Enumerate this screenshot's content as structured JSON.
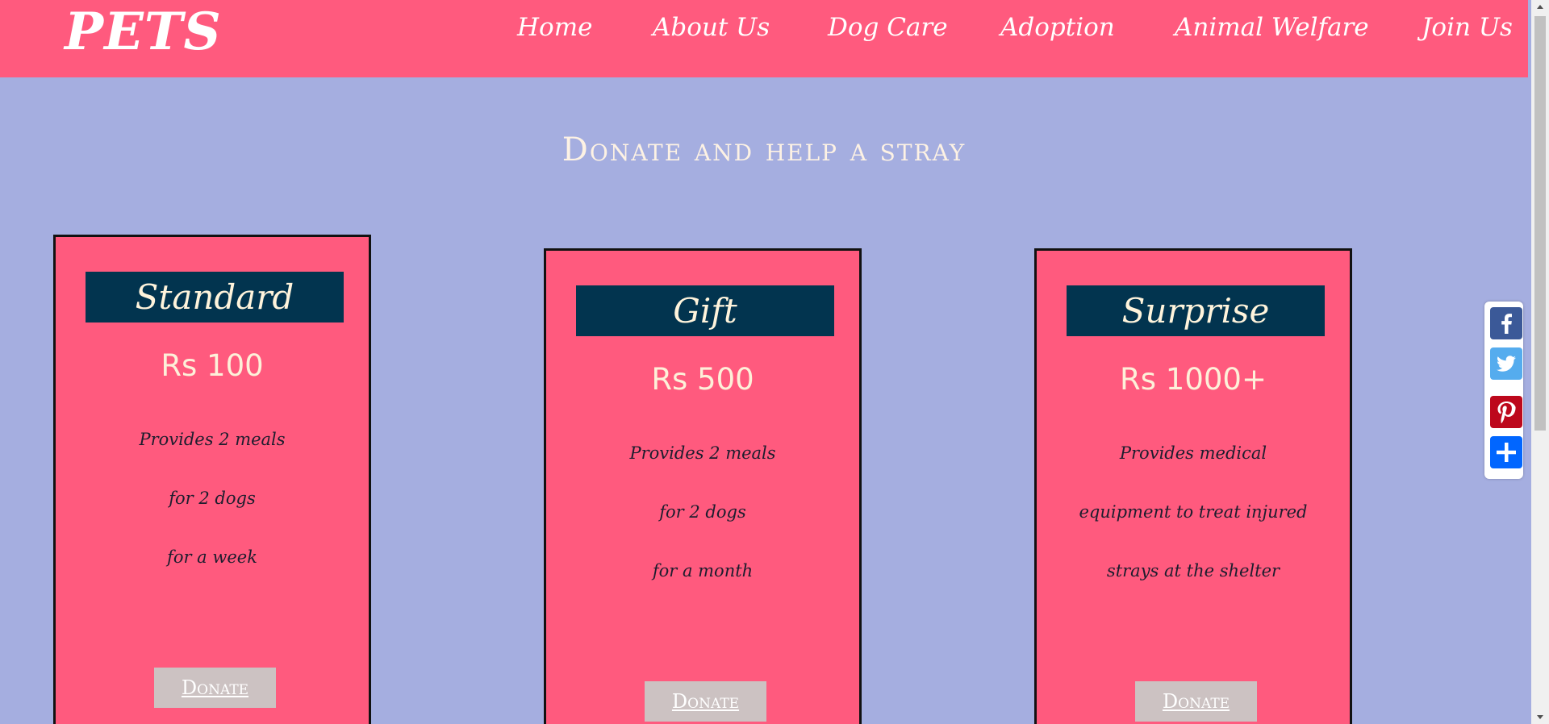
{
  "header": {
    "logo": "PETS",
    "nav": [
      "Home",
      "About Us",
      "Dog Care",
      "Adoption",
      "Animal Welfare",
      "Join Us"
    ]
  },
  "page_title": "Donate and help a stray",
  "cards": [
    {
      "name": "Standard",
      "price": "Rs 100",
      "lines": [
        "Provides 2 meals",
        "for 2 dogs",
        "for a week"
      ],
      "button": "Donate"
    },
    {
      "name": "Gift",
      "price": "Rs 500",
      "lines": [
        "Provides 2 meals",
        "for 2 dogs",
        "for a month"
      ],
      "button": "Donate"
    },
    {
      "name": "Surprise",
      "price": "Rs 1000+",
      "lines": [
        "Provides medical",
        "equipment to treat injured",
        "strays at the shelter"
      ],
      "button": "Donate"
    }
  ],
  "share": [
    {
      "icon": "facebook-icon",
      "color": "#3b5998"
    },
    {
      "icon": "twitter-icon",
      "color": "#55acee"
    },
    {
      "icon": "pinterest-icon",
      "color": "#bd081c"
    },
    {
      "icon": "share-plus-icon",
      "color": "#0166ff"
    }
  ],
  "colors": {
    "header_bg": "#ff5a7e",
    "page_bg": "#a5aee0",
    "card_bg": "#ff5a7e",
    "card_header_bg": "#02344f",
    "button_bg": "#ccc2c2"
  }
}
